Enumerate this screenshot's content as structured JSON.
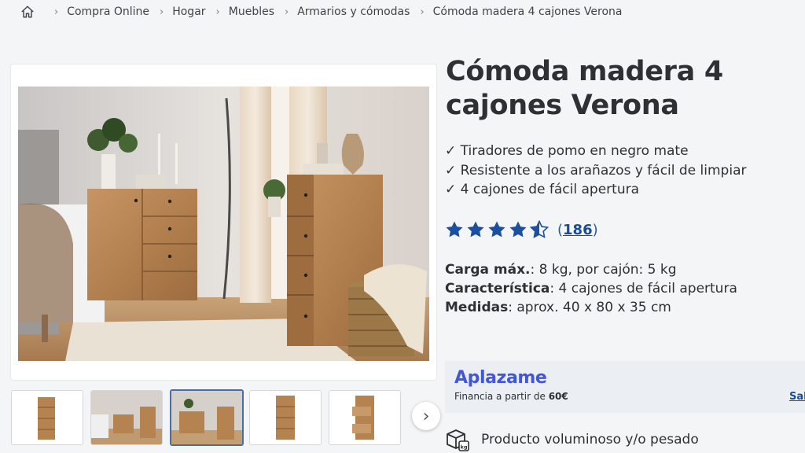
{
  "breadcrumb": {
    "items": [
      "Compra Online",
      "Hogar",
      "Muebles",
      "Armarios y cómodas"
    ],
    "current": "Cómoda madera 4 cajones Verona"
  },
  "product": {
    "title": "Cómoda madera 4 cajones Verona",
    "features": [
      "✓ Tiradores de pomo en negro mate",
      "✓ Resistente a los arañazos y fácil de limpiar",
      "✓ 4 cajones de fácil apertura"
    ],
    "rating": {
      "stars": 4.5,
      "count_open": "(",
      "count": "186",
      "count_close": ")"
    },
    "specs": [
      {
        "label": "Carga máx.",
        "value": ": 8 kg, por cajón: 5 kg"
      },
      {
        "label": "Característica",
        "value": ": 4 cajones de fácil apertura"
      },
      {
        "label": "Medidas",
        "value": ": aprox. 40 x 80 x 35 cm"
      }
    ]
  },
  "financing": {
    "brand": "Aplazame",
    "text": "Financia a partir de ",
    "amount": "60€",
    "link": "Sab"
  },
  "shipping": {
    "notice": "Producto voluminoso y/o pesado"
  },
  "gallery": {
    "active_index": 2,
    "next_symbol": "›"
  },
  "colors": {
    "accent": "#1a4d95",
    "star": "#1c4f9c",
    "aplazame": "#4256d8"
  }
}
